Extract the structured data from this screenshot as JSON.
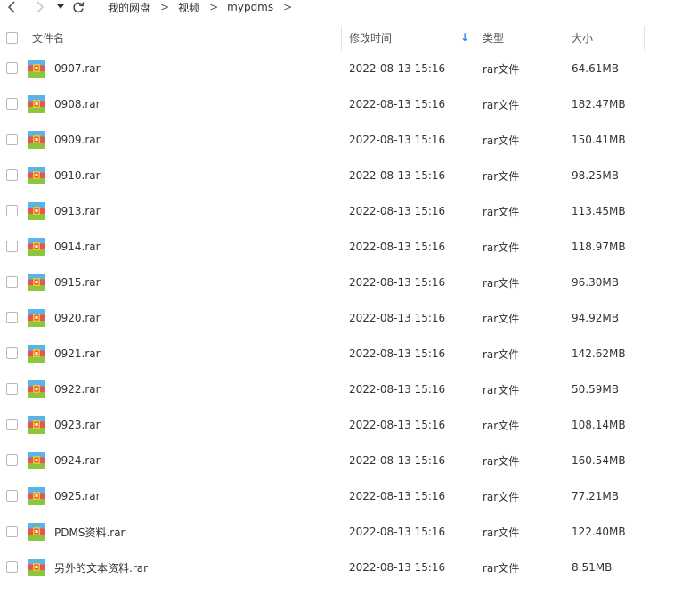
{
  "nav": {
    "back_glyph": "‹",
    "forward_glyph": "›",
    "dropdown_glyph": "▾",
    "refresh_glyph": "⟳"
  },
  "breadcrumb": [
    {
      "label": "我的网盘"
    },
    {
      "label": "视频"
    },
    {
      "label": "mypdms"
    }
  ],
  "breadcrumb_separator": ">",
  "header": {
    "name": "文件名",
    "modified": "修改时间",
    "sort_indicator": "↓",
    "type": "类型",
    "size": "大小"
  },
  "files": [
    {
      "name": "0907.rar",
      "modified": "2022-08-13 15:16",
      "type": "rar文件",
      "size": "64.61MB"
    },
    {
      "name": "0908.rar",
      "modified": "2022-08-13 15:16",
      "type": "rar文件",
      "size": "182.47MB"
    },
    {
      "name": "0909.rar",
      "modified": "2022-08-13 15:16",
      "type": "rar文件",
      "size": "150.41MB"
    },
    {
      "name": "0910.rar",
      "modified": "2022-08-13 15:16",
      "type": "rar文件",
      "size": "98.25MB"
    },
    {
      "name": "0913.rar",
      "modified": "2022-08-13 15:16",
      "type": "rar文件",
      "size": "113.45MB"
    },
    {
      "name": "0914.rar",
      "modified": "2022-08-13 15:16",
      "type": "rar文件",
      "size": "118.97MB"
    },
    {
      "name": "0915.rar",
      "modified": "2022-08-13 15:16",
      "type": "rar文件",
      "size": "96.30MB"
    },
    {
      "name": "0920.rar",
      "modified": "2022-08-13 15:16",
      "type": "rar文件",
      "size": "94.92MB"
    },
    {
      "name": "0921.rar",
      "modified": "2022-08-13 15:16",
      "type": "rar文件",
      "size": "142.62MB"
    },
    {
      "name": "0922.rar",
      "modified": "2022-08-13 15:16",
      "type": "rar文件",
      "size": "50.59MB"
    },
    {
      "name": "0923.rar",
      "modified": "2022-08-13 15:16",
      "type": "rar文件",
      "size": "108.14MB"
    },
    {
      "name": "0924.rar",
      "modified": "2022-08-13 15:16",
      "type": "rar文件",
      "size": "160.54MB"
    },
    {
      "name": "0925.rar",
      "modified": "2022-08-13 15:16",
      "type": "rar文件",
      "size": "77.21MB"
    },
    {
      "name": "PDMS资料.rar",
      "modified": "2022-08-13 15:16",
      "type": "rar文件",
      "size": "122.40MB"
    },
    {
      "name": "另外的文本资料.rar",
      "modified": "2022-08-13 15:16",
      "type": "rar文件",
      "size": "8.51MB"
    }
  ],
  "colors": {
    "sort_arrow": "#2f86f6",
    "archive_icon_top": "#5ab4e5",
    "archive_icon_middle": "#e8554e",
    "archive_icon_bottom": "#8cc63f",
    "archive_icon_center": "#f3c623"
  }
}
